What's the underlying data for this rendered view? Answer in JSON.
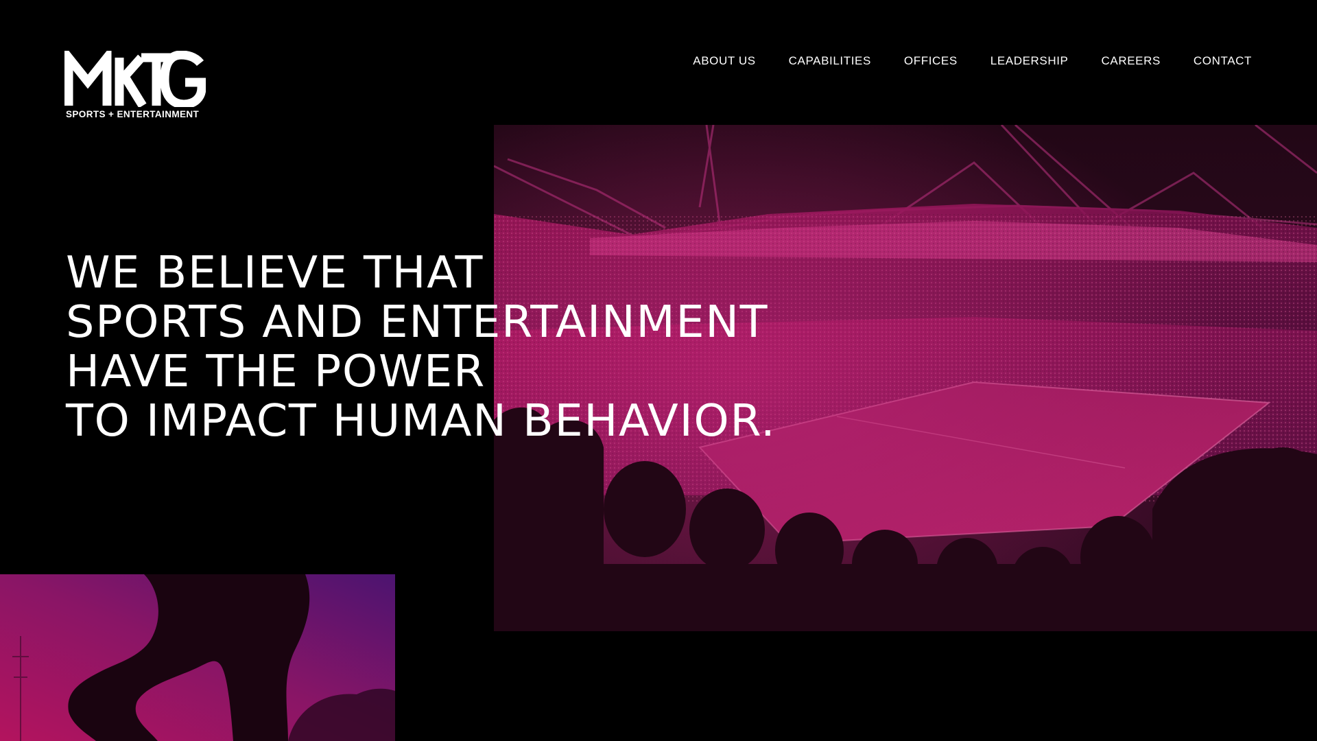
{
  "brand": {
    "logo_text": "MKTG",
    "tagline": "SPORTS + ENTERTAINMENT"
  },
  "nav": {
    "items": [
      {
        "label": "ABOUT US"
      },
      {
        "label": "CAPABILITIES"
      },
      {
        "label": "OFFICES"
      },
      {
        "label": "LEADERSHIP"
      },
      {
        "label": "CAREERS"
      },
      {
        "label": "CONTACT"
      }
    ]
  },
  "hero": {
    "lines": [
      "WE BELIEVE THAT",
      "SPORTS AND ENTERTAINMENT",
      "HAVE THE POWER",
      "TO IMPACT HUMAN BEHAVIOR."
    ]
  },
  "images": {
    "stadium_photo": "stadium-crowd-photo",
    "athlete_photo": "athlete-silhouette-photo"
  },
  "colors": {
    "background": "#000000",
    "text": "#ffffff",
    "accent_magenta": "#c2185b",
    "accent_purple": "#5b1a7a"
  }
}
